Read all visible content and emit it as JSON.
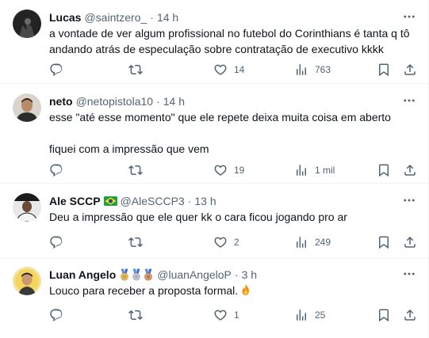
{
  "tweets": [
    {
      "name": "Lucas",
      "handle": "@saintzero_",
      "dot": "·",
      "time": "14 h",
      "lines": [
        "a vontade de ver algum profissional no futebol do Corinthians é tanta q tô",
        "andando atrás de especulação sobre contratação de executivo kkkk"
      ],
      "likes": "14",
      "views": "763"
    },
    {
      "name": "neto",
      "handle": "@netopistola10",
      "dot": "·",
      "time": "14 h",
      "lines": [
        "esse \"até esse momento\" que ele repete deixa muita coisa em aberto",
        "fiquei com a impressão que vem"
      ],
      "likes": "19",
      "views": "1 mil"
    },
    {
      "name": "Ale SCCP",
      "handle": "@AleSCCP3",
      "dot": "·",
      "time": "13 h",
      "lines": [
        "Deu a impressão que ele quer kk o cara ficou jogando pro ar"
      ],
      "likes": "2",
      "views": "249"
    },
    {
      "name": "Luan Angelo",
      "handle": "@luanAngeloP",
      "dot": "·",
      "time": "3 h",
      "lines": [
        "Louco para receber a proposta formal."
      ],
      "likes": "1",
      "views": "25"
    }
  ],
  "icons": {
    "more": "more-horizontal-icon",
    "reply": "reply-icon",
    "retweet": "retweet-icon",
    "like": "like-heart-icon",
    "views": "views-chart-icon",
    "bookmark": "bookmark-icon",
    "share": "share-icon",
    "flag": "brazil-flag-icon",
    "medals": "medal-icon",
    "fire": "fire-emoji-icon"
  },
  "colors": {
    "text": "#0f1419",
    "secondary": "#536471",
    "divider": "#eff3f4"
  }
}
